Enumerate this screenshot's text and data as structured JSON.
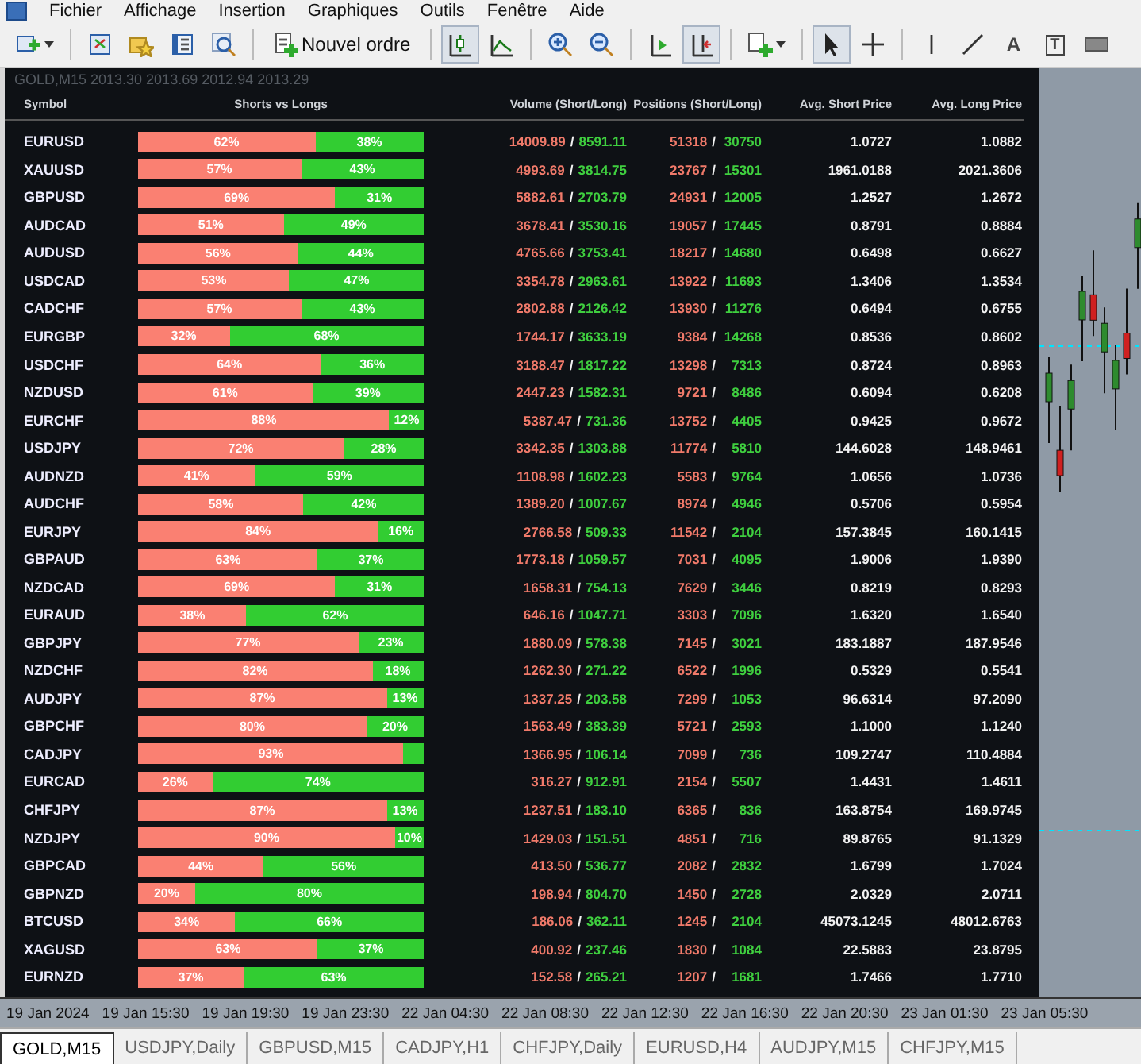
{
  "menu": [
    "Fichier",
    "Affichage",
    "Insertion",
    "Graphiques",
    "Outils",
    "Fenêtre",
    "Aide"
  ],
  "toolbar": [
    {
      "pressed": false
    },
    {
      "pressed": false
    },
    {
      "pressed": false
    },
    {
      "pressed": false
    },
    {
      "pressed": false
    },
    {
      "pressed": false,
      "label": "Nouvel ordre"
    },
    {
      "pressed": true
    },
    {
      "pressed": false
    },
    {
      "pressed": false
    },
    {
      "pressed": false
    },
    {
      "pressed": false
    },
    {
      "pressed": true
    },
    {
      "pressed": false
    },
    {
      "pressed": true
    },
    {
      "pressed": false
    },
    {
      "pressed": false
    },
    {
      "pressed": false
    },
    {
      "pressed": false,
      "label": "A"
    },
    {
      "pressed": false,
      "label": "T"
    },
    {
      "pressed": false
    }
  ],
  "chart_title": "GOLD,M15  2013.30 2013.69 2012.94 2013.29",
  "table": {
    "columns": [
      "Symbol",
      "Shorts vs Longs",
      "Volume (Short/Long)",
      "Positions (Short/Long)",
      "Avg. Short Price",
      "Avg. Long Price"
    ],
    "rows": [
      {
        "symbol": "EURUSD",
        "level": 0.62,
        "short_pct": "62%",
        "long_pct": "38%",
        "volume": [
          "14009.89",
          "/",
          "8591.11"
        ],
        "positions": [
          "51318",
          "/",
          "30750"
        ],
        "avg_short": "1.0727",
        "avg_long": "1.0882"
      },
      {
        "symbol": "XAUUSD",
        "level": 0.57,
        "short_pct": "57%",
        "long_pct": "43%",
        "volume": [
          "4993.69",
          "/",
          "3814.75"
        ],
        "positions": [
          "23767",
          "/",
          "15301"
        ],
        "avg_short": "1961.0188",
        "avg_long": "2021.3606"
      },
      {
        "symbol": "GBPUSD",
        "level": 0.69,
        "short_pct": "69%",
        "long_pct": "31%",
        "volume": [
          "5882.61",
          "/",
          "2703.79"
        ],
        "positions": [
          "24931",
          "/",
          "12005"
        ],
        "avg_short": "1.2527",
        "avg_long": "1.2672"
      },
      {
        "symbol": "AUDCAD",
        "level": 0.51,
        "short_pct": "51%",
        "long_pct": "49%",
        "volume": [
          "3678.41",
          "/",
          "3530.16"
        ],
        "positions": [
          "19057",
          "/",
          "17445"
        ],
        "avg_short": "0.8791",
        "avg_long": "0.8884"
      },
      {
        "symbol": "AUDUSD",
        "level": 0.56,
        "short_pct": "56%",
        "long_pct": "44%",
        "volume": [
          "4765.66",
          "/",
          "3753.41"
        ],
        "positions": [
          "18217",
          "/",
          "14680"
        ],
        "avg_short": "0.6498",
        "avg_long": "0.6627"
      },
      {
        "symbol": "USDCAD",
        "level": 0.53,
        "short_pct": "53%",
        "long_pct": "47%",
        "volume": [
          "3354.78",
          "/",
          "2963.61"
        ],
        "positions": [
          "13922",
          "/",
          "11693"
        ],
        "avg_short": "1.3406",
        "avg_long": "1.3534"
      },
      {
        "symbol": "CADCHF",
        "level": 0.57,
        "short_pct": "57%",
        "long_pct": "43%",
        "volume": [
          "2802.88",
          "/",
          "2126.42"
        ],
        "positions": [
          "13930",
          "/",
          "11276"
        ],
        "avg_short": "0.6494",
        "avg_long": "0.6755"
      },
      {
        "symbol": "EURGBP",
        "level": 0.32,
        "short_pct": "32%",
        "long_pct": "68%",
        "volume": [
          "1744.17",
          "/",
          "3633.19"
        ],
        "positions": [
          "9384",
          "/",
          "14268"
        ],
        "avg_short": "0.8536",
        "avg_long": "0.8602"
      },
      {
        "symbol": "USDCHF",
        "level": 0.64,
        "short_pct": "64%",
        "long_pct": "36%",
        "volume": [
          "3188.47",
          "/",
          "1817.22"
        ],
        "positions": [
          "13298",
          "/",
          "7313"
        ],
        "avg_short": "0.8724",
        "avg_long": "0.8963"
      },
      {
        "symbol": "NZDUSD",
        "level": 0.61,
        "short_pct": "61%",
        "long_pct": "39%",
        "volume": [
          "2447.23",
          "/",
          "1582.31"
        ],
        "positions": [
          "9721",
          "/",
          "8486"
        ],
        "avg_short": "0.6094",
        "avg_long": "0.6208"
      },
      {
        "symbol": "EURCHF",
        "level": 0.88,
        "short_pct": "88%",
        "long_pct": "12%",
        "volume": [
          "5387.47",
          "/",
          "731.36"
        ],
        "positions": [
          "13752",
          "/",
          "4405"
        ],
        "avg_short": "0.9425",
        "avg_long": "0.9672"
      },
      {
        "symbol": "USDJPY",
        "level": 0.72,
        "short_pct": "72%",
        "long_pct": "28%",
        "volume": [
          "3342.35",
          "/",
          "1303.88"
        ],
        "positions": [
          "11774",
          "/",
          "5810"
        ],
        "avg_short": "144.6028",
        "avg_long": "148.9461"
      },
      {
        "symbol": "AUDNZD",
        "level": 0.41,
        "short_pct": "41%",
        "long_pct": "59%",
        "volume": [
          "1108.98",
          "/",
          "1602.23"
        ],
        "positions": [
          "5583",
          "/",
          "9764"
        ],
        "avg_short": "1.0656",
        "avg_long": "1.0736"
      },
      {
        "symbol": "AUDCHF",
        "level": 0.58,
        "short_pct": "58%",
        "long_pct": "42%",
        "volume": [
          "1389.20",
          "/",
          "1007.67"
        ],
        "positions": [
          "8974",
          "/",
          "4946"
        ],
        "avg_short": "0.5706",
        "avg_long": "0.5954"
      },
      {
        "symbol": "EURJPY",
        "level": 0.84,
        "short_pct": "84%",
        "long_pct": "16%",
        "volume": [
          "2766.58",
          "/",
          "509.33"
        ],
        "positions": [
          "11542",
          "/",
          "2104"
        ],
        "avg_short": "157.3845",
        "avg_long": "160.1415"
      },
      {
        "symbol": "GBPAUD",
        "level": 0.63,
        "short_pct": "63%",
        "long_pct": "37%",
        "volume": [
          "1773.18",
          "/",
          "1059.57"
        ],
        "positions": [
          "7031",
          "/",
          "4095"
        ],
        "avg_short": "1.9006",
        "avg_long": "1.9390"
      },
      {
        "symbol": "NZDCAD",
        "level": 0.69,
        "short_pct": "69%",
        "long_pct": "31%",
        "volume": [
          "1658.31",
          "/",
          "754.13"
        ],
        "positions": [
          "7629",
          "/",
          "3446"
        ],
        "avg_short": "0.8219",
        "avg_long": "0.8293"
      },
      {
        "symbol": "EURAUD",
        "level": 0.38,
        "short_pct": "38%",
        "long_pct": "62%",
        "volume": [
          "646.16",
          "/",
          "1047.71"
        ],
        "positions": [
          "3303",
          "/",
          "7096"
        ],
        "avg_short": "1.6320",
        "avg_long": "1.6540"
      },
      {
        "symbol": "GBPJPY",
        "level": 0.77,
        "short_pct": "77%",
        "long_pct": "23%",
        "volume": [
          "1880.09",
          "/",
          "578.38"
        ],
        "positions": [
          "7145",
          "/",
          "3021"
        ],
        "avg_short": "183.1887",
        "avg_long": "187.9546"
      },
      {
        "symbol": "NZDCHF",
        "level": 0.82,
        "short_pct": "82%",
        "long_pct": "18%",
        "volume": [
          "1262.30",
          "/",
          "271.22"
        ],
        "positions": [
          "6522",
          "/",
          "1996"
        ],
        "avg_short": "0.5329",
        "avg_long": "0.5541"
      },
      {
        "symbol": "AUDJPY",
        "level": 0.87,
        "short_pct": "87%",
        "long_pct": "13%",
        "volume": [
          "1337.25",
          "/",
          "203.58"
        ],
        "positions": [
          "7299",
          "/",
          "1053"
        ],
        "avg_short": "96.6314",
        "avg_long": "97.2090"
      },
      {
        "symbol": "GBPCHF",
        "level": 0.8,
        "short_pct": "80%",
        "long_pct": "20%",
        "volume": [
          "1563.49",
          "/",
          "383.39"
        ],
        "positions": [
          "5721",
          "/",
          "2593"
        ],
        "avg_short": "1.1000",
        "avg_long": "1.1240"
      },
      {
        "symbol": "CADJPY",
        "level": 0.93,
        "short_pct": "93%",
        "volume": [
          "1366.95",
          "/",
          "106.14"
        ],
        "positions": [
          "7099",
          "/",
          "736"
        ],
        "avg_short": "109.2747",
        "avg_long": "110.4884"
      },
      {
        "symbol": "EURCAD",
        "level": 0.26,
        "short_pct": "26%",
        "long_pct": "74%",
        "volume": [
          "316.27",
          "/",
          "912.91"
        ],
        "positions": [
          "2154",
          "/",
          "5507"
        ],
        "avg_short": "1.4431",
        "avg_long": "1.4611"
      },
      {
        "symbol": "CHFJPY",
        "level": 0.87,
        "short_pct": "87%",
        "long_pct": "13%",
        "volume": [
          "1237.51",
          "/",
          "183.10"
        ],
        "positions": [
          "6365",
          "/",
          "836"
        ],
        "avg_short": "163.8754",
        "avg_long": "169.9745"
      },
      {
        "symbol": "NZDJPY",
        "level": 0.9,
        "short_pct": "90%",
        "long_pct": "10%",
        "volume": [
          "1429.03",
          "/",
          "151.51"
        ],
        "positions": [
          "4851",
          "/",
          "716"
        ],
        "avg_short": "89.8765",
        "avg_long": "91.1329"
      },
      {
        "symbol": "GBPCAD",
        "level": 0.44,
        "short_pct": "44%",
        "long_pct": "56%",
        "volume": [
          "413.50",
          "/",
          "536.77"
        ],
        "positions": [
          "2082",
          "/",
          "2832"
        ],
        "avg_short": "1.6799",
        "avg_long": "1.7024"
      },
      {
        "symbol": "GBPNZD",
        "level": 0.2,
        "short_pct": "20%",
        "long_pct": "80%",
        "volume": [
          "198.94",
          "/",
          "804.70"
        ],
        "positions": [
          "1450",
          "/",
          "2728"
        ],
        "avg_short": "2.0329",
        "avg_long": "2.0711"
      },
      {
        "symbol": "BTCUSD",
        "level": 0.34,
        "short_pct": "34%",
        "long_pct": "66%",
        "volume": [
          "186.06",
          "/",
          "362.11"
        ],
        "positions": [
          "1245",
          "/",
          "2104"
        ],
        "avg_short": "45073.1245",
        "avg_long": "48012.6763"
      },
      {
        "symbol": "XAGUSD",
        "level": 0.63,
        "short_pct": "63%",
        "long_pct": "37%",
        "volume": [
          "400.92",
          "/",
          "237.46"
        ],
        "positions": [
          "1830",
          "/",
          "1084"
        ],
        "avg_short": "22.5883",
        "avg_long": "23.8795"
      },
      {
        "symbol": "EURNZD",
        "level": 0.37,
        "short_pct": "37%",
        "long_pct": "63%",
        "volume": [
          "152.58",
          "/",
          "265.21"
        ],
        "positions": [
          "1207",
          "/",
          "1681"
        ],
        "avg_short": "1.7466",
        "avg_long": "1.7710"
      }
    ]
  },
  "time_axis": [
    "19 Jan 2024",
    "19 Jan 15:30",
    "19 Jan 19:30",
    "19 Jan 23:30",
    "22 Jan 04:30",
    "22 Jan 08:30",
    "22 Jan 12:30",
    "22 Jan 16:30",
    "22 Jan 20:30",
    "23 Jan 01:30",
    "23 Jan 05:30"
  ],
  "chart_tabs": [
    {
      "label": "GOLD,M15",
      "selected": true
    },
    {
      "label": "USDJPY,Daily",
      "selected": false
    },
    {
      "label": "GBPUSD,M15",
      "selected": false
    },
    {
      "label": "CADJPY,H1",
      "selected": false
    },
    {
      "label": "CHFJPY,Daily",
      "selected": false
    },
    {
      "label": "EURUSD,H4",
      "selected": false
    },
    {
      "label": "AUDJPY,M15",
      "selected": false
    },
    {
      "label": "CHFJPY,M15",
      "selected": false
    }
  ]
}
